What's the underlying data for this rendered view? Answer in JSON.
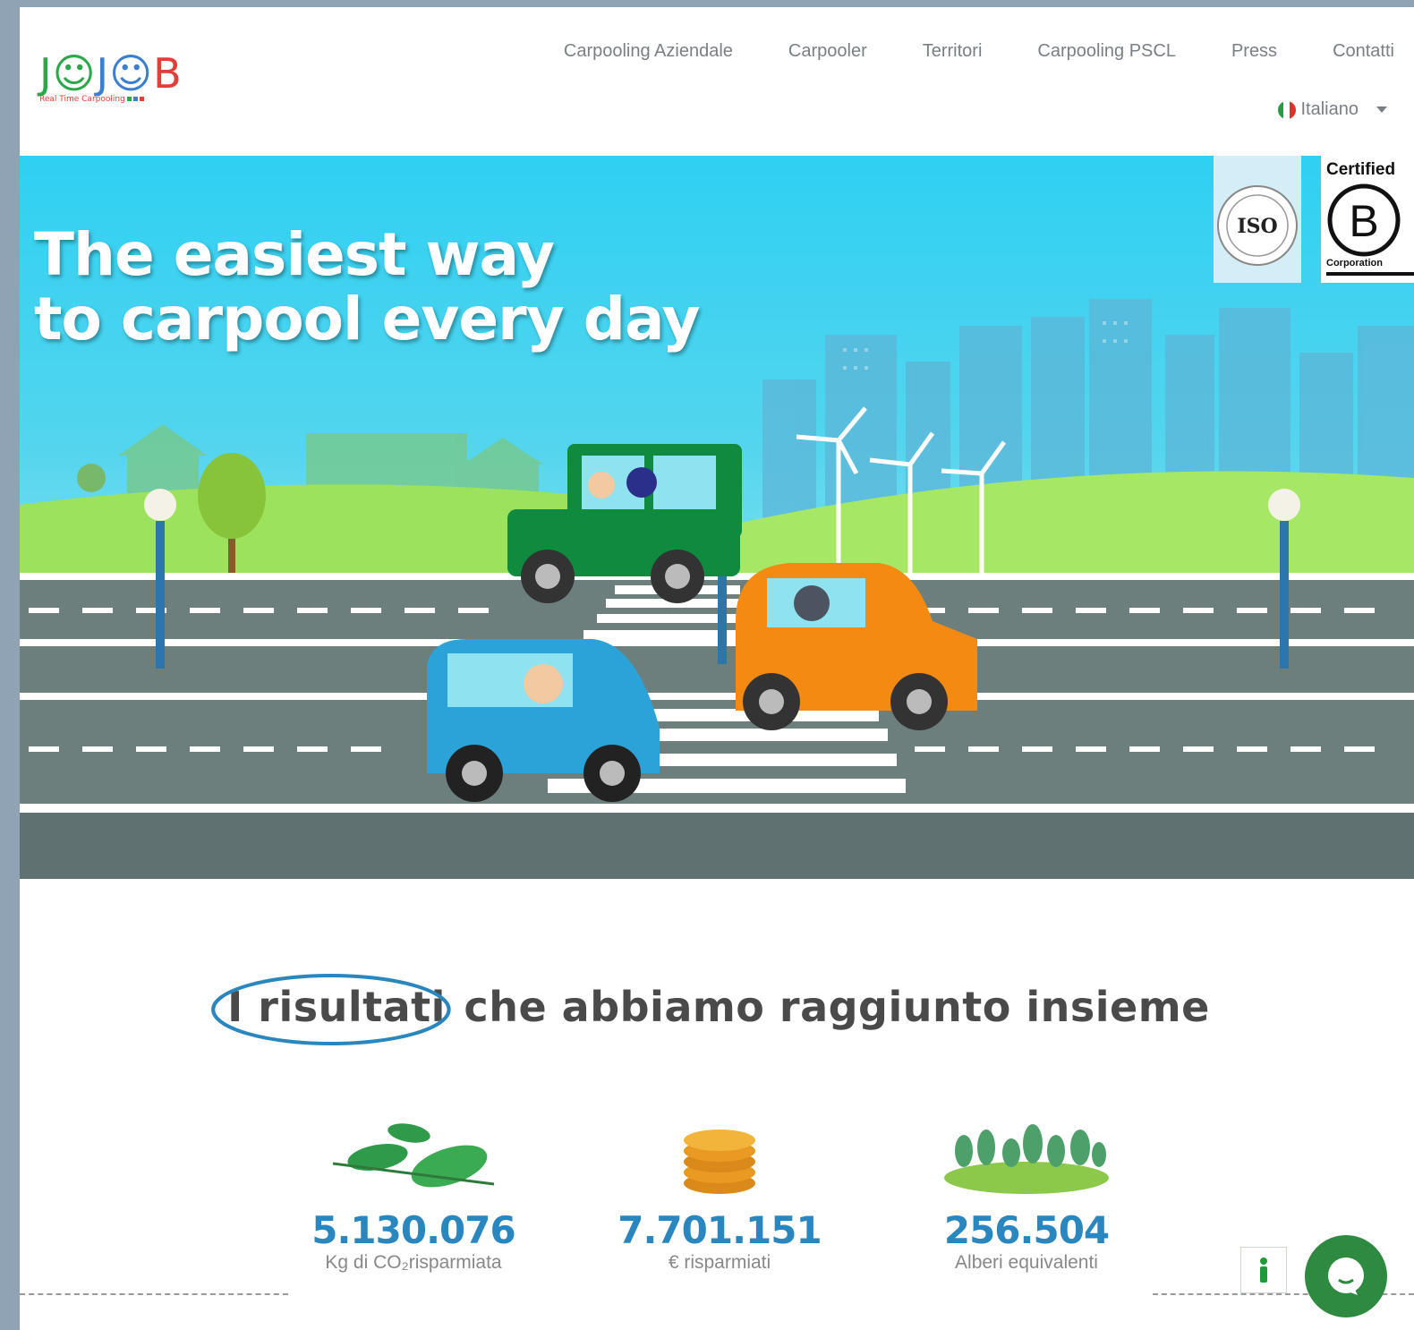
{
  "header": {
    "logo": {
      "text": "JOJOB",
      "tagline": "Real Time Carpooling"
    },
    "nav": [
      {
        "label": "Carpooling Aziendale"
      },
      {
        "label": "Carpooler"
      },
      {
        "label": "Territori"
      },
      {
        "label": "Carpooling PSCL"
      },
      {
        "label": "Press"
      },
      {
        "label": "Contatti"
      }
    ],
    "language": {
      "selected": "Italiano",
      "flag": "italy-flag-icon"
    }
  },
  "hero": {
    "title_line1": "The easiest way",
    "title_line2": "to carpool every day",
    "badges": {
      "iso": "ISO",
      "b_certified": "Certified",
      "b_letter": "B",
      "b_corporation": "Corporation"
    }
  },
  "results": {
    "title_highlight": "I risultati",
    "title_rest": "che abbiamo raggiunto insieme",
    "stats": [
      {
        "value": "5.130.076",
        "label": "Kg di CO₂risparmiata",
        "icon": "leaves-icon"
      },
      {
        "value": "7.701.151",
        "label": "€ risparmiati",
        "icon": "coins-icon"
      },
      {
        "value": "256.504",
        "label": "Alberi equivalenti",
        "icon": "trees-icon"
      }
    ]
  },
  "colors": {
    "accent_blue": "#2a86bf",
    "sky": "#2fd0f2",
    "grass": "#9ce25c",
    "chat_green": "#2e8a40",
    "logo_green": "#2aa84a",
    "logo_blue": "#3a7fd0",
    "logo_red": "#e0403a"
  }
}
